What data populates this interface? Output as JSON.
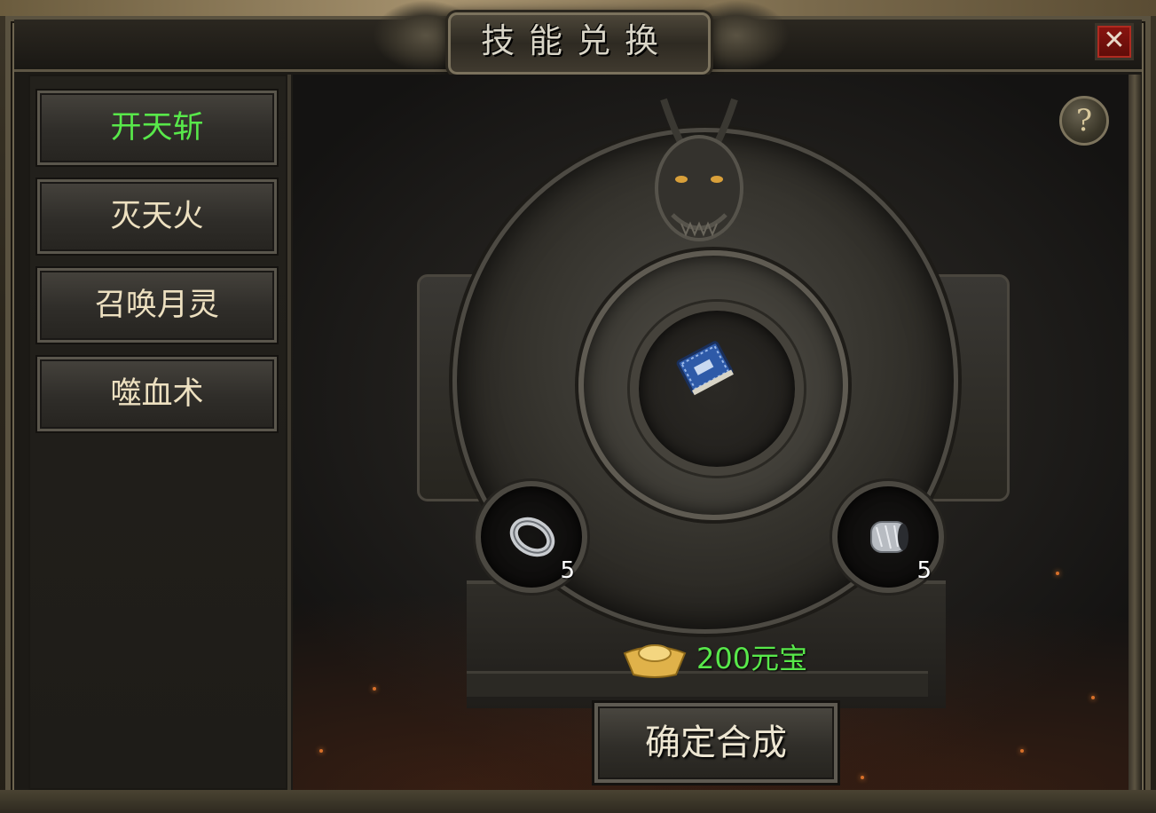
{
  "window": {
    "title": "技能兑换",
    "close_symbol": "✕",
    "help_symbol": "?"
  },
  "sidebar": {
    "items": [
      {
        "label": "开天斩",
        "active": true
      },
      {
        "label": "灭天火",
        "active": false
      },
      {
        "label": "召唤月灵",
        "active": false
      },
      {
        "label": "噬血术",
        "active": false
      }
    ]
  },
  "main": {
    "result_item_icon": "skill-book-icon",
    "materials": [
      {
        "icon": "silver-ring-icon",
        "quantity": "5"
      },
      {
        "icon": "silver-bracelet-icon",
        "quantity": "5"
      }
    ],
    "cost": {
      "icon": "gold-ingot-icon",
      "text": "200元宝"
    },
    "confirm_label": "确定合成"
  },
  "colors": {
    "active_text": "#58e84a",
    "cost_text": "#58e84a",
    "button_text": "#ede0c0",
    "close_bg": "#8a1410"
  }
}
